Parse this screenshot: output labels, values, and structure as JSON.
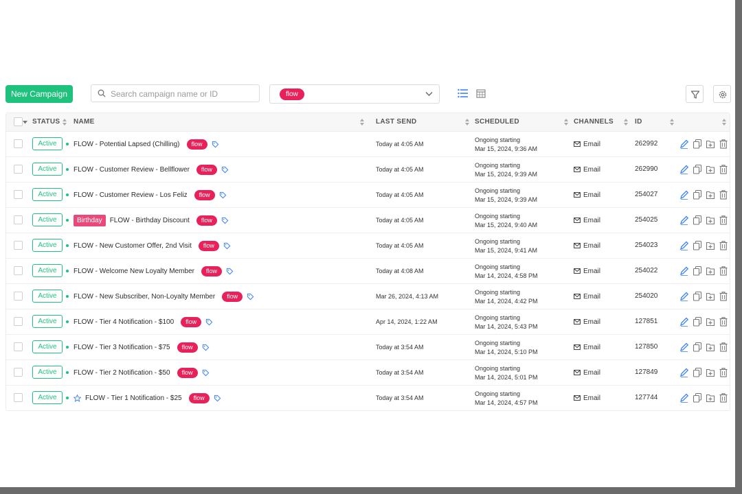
{
  "toolbar": {
    "new_campaign_label": "New Campaign",
    "search_placeholder": "Search campaign name or ID",
    "filter_chip": "flow"
  },
  "table": {
    "headers": {
      "status": "STATUS",
      "name": "NAME",
      "last_send": "LAST SEND",
      "scheduled": "SCHEDULED",
      "channels": "CHANNELS",
      "id": "ID"
    },
    "rows": [
      {
        "status": "Active",
        "birthday": "",
        "star": false,
        "name": "FLOW - Potential Lapsed (Chilling)",
        "tag": "flow",
        "last_send": "Today at 4:05 AM",
        "sched_1": "Ongoing starting",
        "sched_2": "Mar 15, 2024, 9:36 AM",
        "channel": "Email",
        "id": "262992"
      },
      {
        "status": "Active",
        "birthday": "",
        "star": false,
        "name": "FLOW - Customer Review - Bellflower",
        "tag": "flow",
        "last_send": "Today at 4:05 AM",
        "sched_1": "Ongoing starting",
        "sched_2": "Mar 15, 2024, 9:39 AM",
        "channel": "Email",
        "id": "262990"
      },
      {
        "status": "Active",
        "birthday": "",
        "star": false,
        "name": "FLOW - Customer Review - Los Feliz",
        "tag": "flow",
        "last_send": "Today at 4:05 AM",
        "sched_1": "Ongoing starting",
        "sched_2": "Mar 15, 2024, 9:39 AM",
        "channel": "Email",
        "id": "254027"
      },
      {
        "status": "Active",
        "birthday": "Birthday",
        "star": false,
        "name": "FLOW - Birthday Discount",
        "tag": "flow",
        "last_send": "Today at 4:05 AM",
        "sched_1": "Ongoing starting",
        "sched_2": "Mar 15, 2024, 9:40 AM",
        "channel": "Email",
        "id": "254025"
      },
      {
        "status": "Active",
        "birthday": "",
        "star": false,
        "name": "FLOW - New Customer Offer, 2nd Visit",
        "tag": "flow",
        "last_send": "Today at 4:05 AM",
        "sched_1": "Ongoing starting",
        "sched_2": "Mar 15, 2024, 9:41 AM",
        "channel": "Email",
        "id": "254023"
      },
      {
        "status": "Active",
        "birthday": "",
        "star": false,
        "name": "FLOW - Welcome New Loyalty Member",
        "tag": "flow",
        "last_send": "Today at 4:08 AM",
        "sched_1": "Ongoing starting",
        "sched_2": "Mar 14, 2024, 4:58 PM",
        "channel": "Email",
        "id": "254022"
      },
      {
        "status": "Active",
        "birthday": "",
        "star": false,
        "name": "FLOW - New Subscriber, Non-Loyalty Member",
        "tag": "flow",
        "last_send": "Mar 26, 2024, 4:13 AM",
        "sched_1": "Ongoing starting",
        "sched_2": "Mar 14, 2024, 4:42 PM",
        "channel": "Email",
        "id": "254020"
      },
      {
        "status": "Active",
        "birthday": "",
        "star": false,
        "name": "FLOW - Tier 4 Notification - $100",
        "tag": "flow",
        "last_send": "Apr 14, 2024, 1:22 AM",
        "sched_1": "Ongoing starting",
        "sched_2": "Mar 14, 2024, 5:43 PM",
        "channel": "Email",
        "id": "127851"
      },
      {
        "status": "Active",
        "birthday": "",
        "star": false,
        "name": "FLOW - Tier 3 Notification - $75",
        "tag": "flow",
        "last_send": "Today at 3:54 AM",
        "sched_1": "Ongoing starting",
        "sched_2": "Mar 14, 2024, 5:10 PM",
        "channel": "Email",
        "id": "127850"
      },
      {
        "status": "Active",
        "birthday": "",
        "star": false,
        "name": "FLOW - Tier 2 Notification - $50",
        "tag": "flow",
        "last_send": "Today at 3:54 AM",
        "sched_1": "Ongoing starting",
        "sched_2": "Mar 14, 2024, 5:01 PM",
        "channel": "Email",
        "id": "127849"
      },
      {
        "status": "Active",
        "birthday": "",
        "star": true,
        "name": "FLOW - Tier 1 Notification - $25",
        "tag": "flow",
        "last_send": "Today at 3:54 AM",
        "sched_1": "Ongoing starting",
        "sched_2": "Mar 14, 2024, 4:57 PM",
        "channel": "Email",
        "id": "127744"
      }
    ]
  },
  "colors": {
    "accent_green": "#1fc27d",
    "tag_pink": "#e8215a",
    "icon_blue": "#3b82f6"
  },
  "icons": [
    "search-icon",
    "chevron-down-icon",
    "list-view-icon",
    "calendar-view-icon",
    "filter-icon",
    "gear-icon",
    "tag-icon",
    "star-icon",
    "email-icon",
    "edit-icon",
    "copy-icon",
    "add-icon",
    "delete-icon",
    "sort-icon"
  ]
}
